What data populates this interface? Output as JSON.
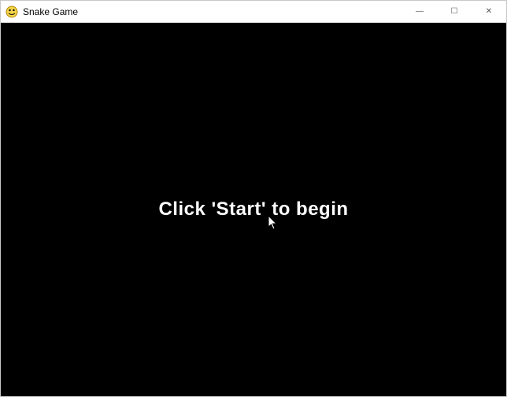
{
  "window": {
    "title": "Snake Game",
    "icon_name": "snake-icon"
  },
  "controls": {
    "minimize_glyph": "—",
    "maximize_glyph": "☐",
    "close_glyph": "✕"
  },
  "game": {
    "prompt": "Click 'Start' to begin"
  }
}
